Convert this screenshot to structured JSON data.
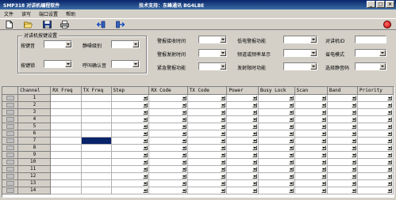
{
  "window": {
    "title": "SMP318  对讲机编程软件",
    "support": "技术支持：东峰通讯  BG4LBE"
  },
  "menu": [
    "文件",
    "读写",
    "端口设置",
    "帮助"
  ],
  "toolbar": {
    "icons": [
      "new-file-icon",
      "open-folder-icon",
      "save-icon",
      "print-icon",
      "read-radio-icon",
      "write-radio-icon",
      "stop-icon"
    ]
  },
  "key_group": {
    "title": "对讲机按键设置",
    "fields": [
      {
        "label": "按键音"
      },
      {
        "label": "静噪级别"
      },
      {
        "label": "按键锁"
      },
      {
        "label": "呼叫确认音"
      }
    ]
  },
  "settings": {
    "col1": [
      {
        "label": "警报接收时间"
      },
      {
        "label": "警报发射时间"
      },
      {
        "label": "紧急警报功能"
      }
    ],
    "col2": [
      {
        "label": "低电警报功能"
      },
      {
        "label": "频道或频率显示"
      },
      {
        "label": "发射限时功能"
      }
    ],
    "col3": [
      {
        "label": "对讲机ID"
      },
      {
        "label": "省电模式"
      },
      {
        "label": "选择静音码"
      }
    ]
  },
  "grid": {
    "columns": [
      "Channel",
      "RX Freq",
      "TX Freq",
      "Step",
      "RX Code",
      "TX Code",
      "Power",
      "Busy Lock",
      "Scan",
      "Band",
      "Priority"
    ],
    "rows": [
      "1",
      "2",
      "3",
      "4",
      "5",
      "6",
      "7",
      "8",
      "9",
      "10",
      "11",
      "12",
      "13",
      "14"
    ],
    "selected_row": "7",
    "selected_column": "TX Freq",
    "colors": {
      "selection": "#0a246a",
      "window": "#d4d0c8"
    }
  }
}
